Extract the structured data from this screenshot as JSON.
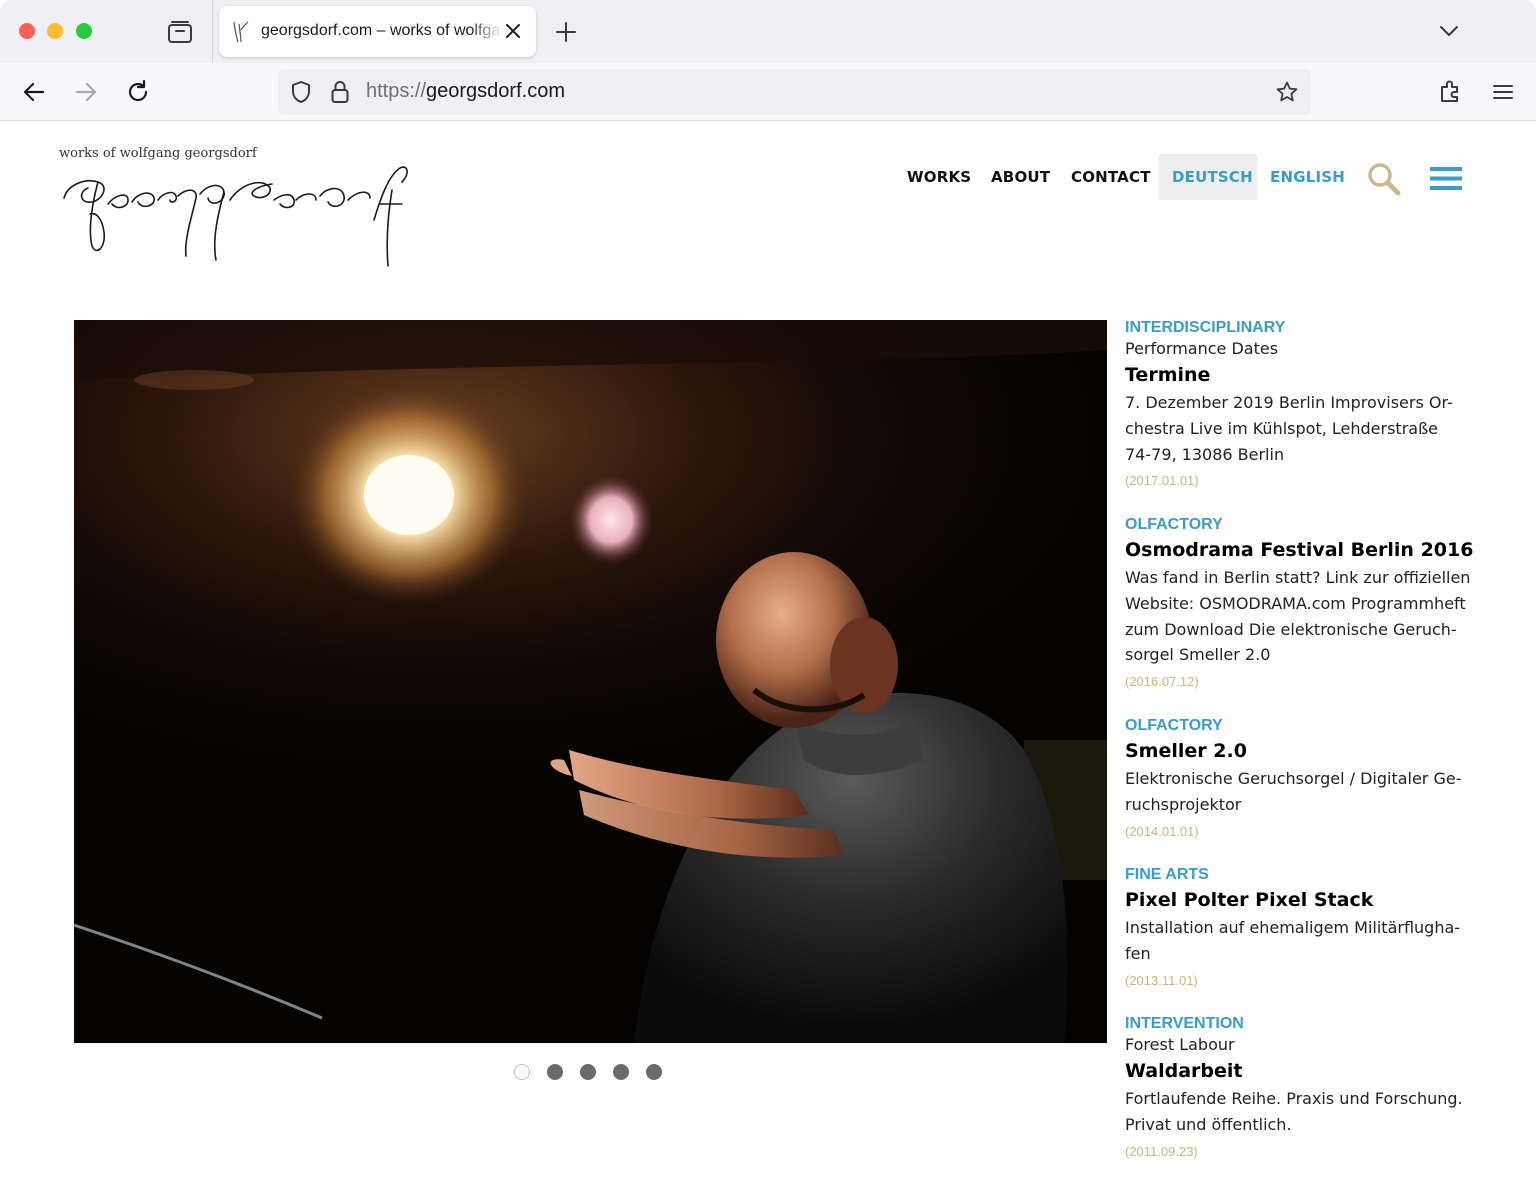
{
  "browser": {
    "tab_title": "georgsdorf.com – works of wolfgang georgsdorf",
    "url_scheme": "https://",
    "url_host": "georgsdorf.com"
  },
  "site": {
    "logo_caption": "works of wolfgang georgsdorf",
    "logo_signature": "georgsdorf",
    "nav": [
      {
        "label": "WORKS"
      },
      {
        "label": "ABOUT"
      },
      {
        "label": "CONTACT"
      },
      {
        "label": "DEUTSCH"
      },
      {
        "label": "ENGLISH"
      }
    ],
    "active_language": "DEUTSCH",
    "accent_color": "#3a9cc8",
    "date_color": "#c8b77a"
  },
  "slideshow": {
    "slide_count": 5,
    "active_slide": 1
  },
  "news": [
    {
      "category": "INTERDISCIPLINARY",
      "subtitle": "Performance Dates",
      "title": "Termine",
      "body_lines": [
        "7. Dezember 2019 Berlin Improvisers Or-",
        "chestra Live im Kühlspot, Lehderstraße",
        "74-79, 13086 Berlin"
      ],
      "date": "(2017.01.01)"
    },
    {
      "category": "OLFACTORY",
      "subtitle": "",
      "title": "Osmodrama Festival Berlin 2016",
      "body_lines": [
        "Was fand in Berlin statt? Link zur offiziellen",
        "Website: OSMODRAMA.com Programmheft",
        "zum Download Die elektronische Geruch-",
        "sorgel Smeller 2.0"
      ],
      "date": "(2016.07.12)"
    },
    {
      "category": "OLFACTORY",
      "subtitle": "",
      "title": "Smeller 2.0",
      "body_lines": [
        "Elektronische Geruchsorgel / Digitaler Ge-",
        "ruchsprojektor"
      ],
      "date": "(2014.01.01)"
    },
    {
      "category": "FINE ARTS",
      "subtitle": "",
      "title": "Pixel Polter Pixel Stack",
      "body_lines": [
        "Installation auf ehemaligem Militärflugha-",
        "fen"
      ],
      "date": "(2013.11.01)"
    },
    {
      "category": "INTERVENTION",
      "subtitle": "Forest Labour",
      "title": "Waldarbeit",
      "body_lines": [
        "Fortlaufende Reihe. Praxis und Forschung.",
        "Privat und öffentlich."
      ],
      "date": "(2011.09.23)"
    }
  ]
}
